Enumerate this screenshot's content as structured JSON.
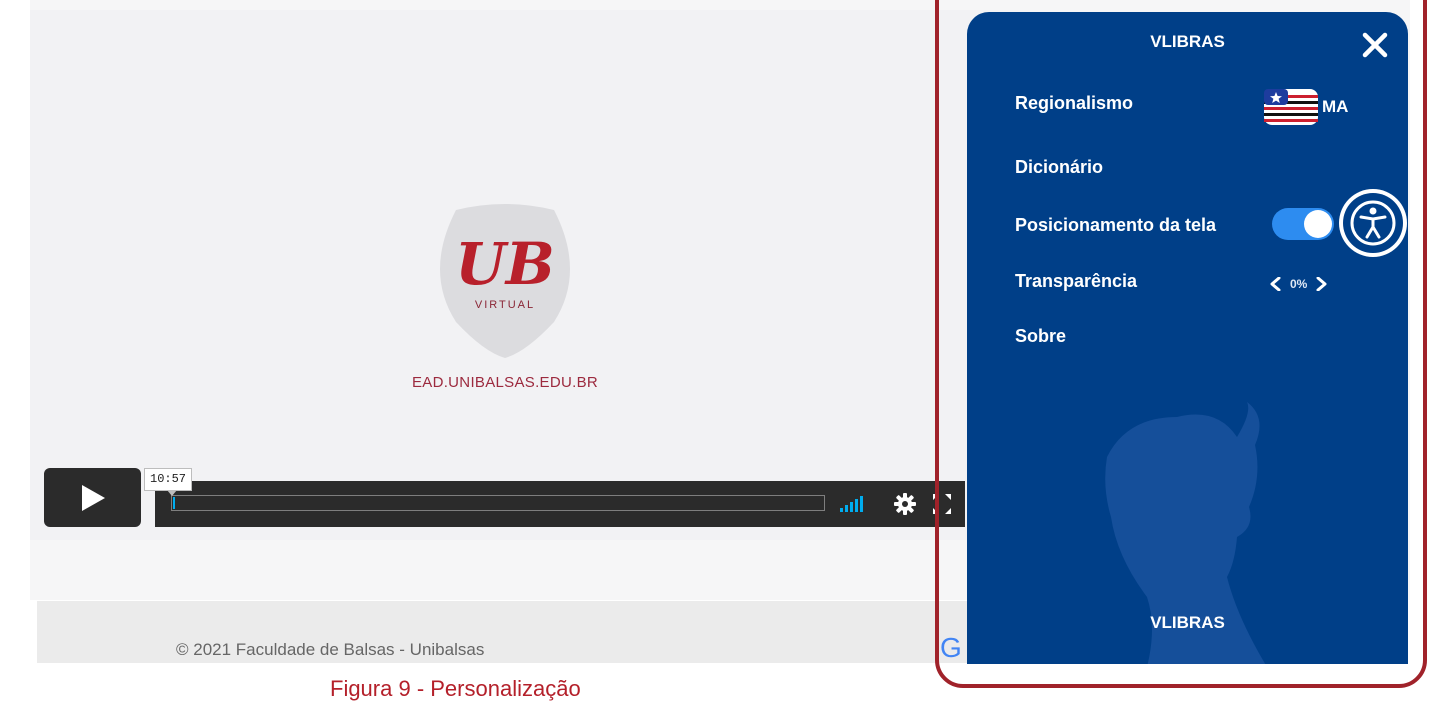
{
  "video": {
    "logo_letters": "UB",
    "logo_subtitle": "VIRTUAL",
    "logo_url": "EAD.UNIBALSAS.EDU.BR",
    "time_tooltip": "10:57",
    "progress_fraction": 0.003
  },
  "footer": {
    "copyright": "© 2021 Faculdade de Balsas - Unibalsas",
    "partial_logo": "G"
  },
  "caption": "Figura 9 - Personalização",
  "vlibras": {
    "title": "VLIBRAS",
    "close_icon": "close-icon",
    "menu": {
      "regionalismo": "Regionalismo",
      "dicionario": "Dicionário",
      "posicionamento": "Posicionamento da tela",
      "transparencia": "Transparência",
      "sobre": "Sobre"
    },
    "region_code": "MA",
    "positioning_enabled": true,
    "transparency_value": "0%",
    "footer_label": "VLIBRAS"
  },
  "colors": {
    "panel": "#003f88",
    "toggle": "#2d8cf0",
    "accent_red": "#b4202a",
    "player_bar": "#2b2b2b",
    "progress": "#00adef"
  }
}
